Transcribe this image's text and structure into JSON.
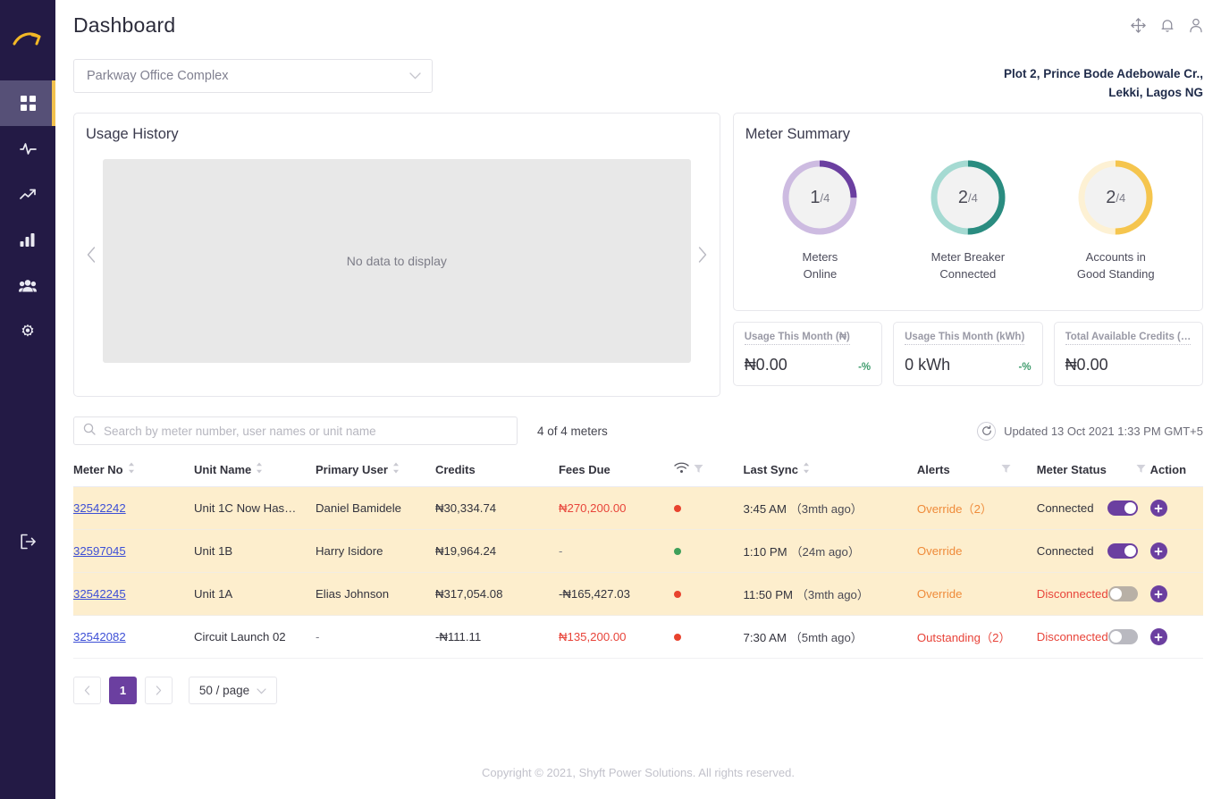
{
  "sidebar": {
    "logo_icon": "arrow-logo-icon",
    "items": [
      {
        "icon": "grid-dashboard-icon",
        "name": "dashboard",
        "active": true
      },
      {
        "icon": "activity-pulse-icon",
        "name": "activity",
        "active": false
      },
      {
        "icon": "trending-up-icon",
        "name": "trends",
        "active": false
      },
      {
        "icon": "bar-chart-icon",
        "name": "reports",
        "active": false
      },
      {
        "icon": "users-group-icon",
        "name": "users",
        "active": false
      },
      {
        "icon": "gear-settings-icon",
        "name": "settings",
        "active": false
      }
    ],
    "logout_icon": "logout-icon"
  },
  "header": {
    "title": "Dashboard",
    "icons": [
      "move-arrows-icon",
      "bell-icon",
      "user-account-icon"
    ],
    "address_line1": "Plot 2, Prince Bode Adebowale Cr.,",
    "address_line2": "Lekki, Lagos NG"
  },
  "site_select": {
    "value": "Parkway Office Complex",
    "chevron_icon": "chevron-down-icon"
  },
  "usage_history": {
    "title": "Usage History",
    "empty_message": "No data to display",
    "prev_icon": "chevron-left-icon",
    "next_icon": "chevron-right-icon"
  },
  "meter_summary": {
    "title": "Meter Summary",
    "donuts": [
      {
        "value": "1",
        "denominator": "/4",
        "caption_line1": "Meters",
        "caption_line2": "Online",
        "percent": 25,
        "color": "#6b3fa0",
        "track": "#cdbbe1"
      },
      {
        "value": "2",
        "denominator": "/4",
        "caption_line1": "Meter Breaker",
        "caption_line2": "Connected",
        "percent": 50,
        "color": "#2a8c80",
        "track": "#a5dad2"
      },
      {
        "value": "2",
        "denominator": "/4",
        "caption_line1": "Accounts in",
        "caption_line2": "Good Standing",
        "percent": 50,
        "color": "#f5c54e",
        "track": "#fdf1d4"
      }
    ]
  },
  "stats": [
    {
      "label": "Usage This Month (₦)",
      "value": "₦0.00",
      "delta": "-%"
    },
    {
      "label": "Usage This Month (kWh)",
      "value": "0 kWh",
      "delta": "-%"
    },
    {
      "label": "Total Available Credits (…",
      "value": "₦0.00",
      "delta": ""
    }
  ],
  "toolbar": {
    "search_placeholder": "Search by meter number, user names or unit name",
    "search_value": "",
    "search_icon": "search-icon",
    "meter_count": "4 of 4 meters",
    "refresh_icon": "refresh-icon",
    "updated_text": "Updated 13 Oct 2021 1:33 PM GMT+5"
  },
  "table": {
    "columns": [
      {
        "label": "Meter No",
        "sortable": true,
        "filter": false
      },
      {
        "label": "Unit Name",
        "sortable": true,
        "filter": false
      },
      {
        "label": "Primary User",
        "sortable": true,
        "filter": false
      },
      {
        "label": "Credits",
        "sortable": false,
        "filter": false
      },
      {
        "label": "Fees Due",
        "sortable": false,
        "filter": false
      },
      {
        "label": "",
        "icon": "wifi-icon",
        "sortable": false,
        "filter": true
      },
      {
        "label": "Last Sync",
        "sortable": true,
        "filter": false
      },
      {
        "label": "Alerts",
        "sortable": false,
        "filter": true
      },
      {
        "label": "Meter Status",
        "sortable": false,
        "filter": true
      },
      {
        "label": "Action",
        "sortable": false,
        "filter": false
      }
    ],
    "rows": [
      {
        "highlight": true,
        "meter_no": "32542242",
        "unit_name": "Unit 1C Now Has…",
        "primary_user": "Daniel Bamidele",
        "credits": "₦30,334.74",
        "credits_style": "normal",
        "fees_due": "₦270,200.00",
        "fees_style": "red",
        "signal": "red",
        "last_sync_time": "3:45 AM",
        "last_sync_ago": "（3mth ago）",
        "alerts": "Override（2）",
        "alerts_style": "orange",
        "meter_status": "Connected",
        "status_style": "normal",
        "toggle": "on",
        "action_icon": "plus-circle-icon"
      },
      {
        "highlight": true,
        "meter_no": "32597045",
        "unit_name": "Unit 1B",
        "primary_user": "Harry Isidore",
        "credits": "₦19,964.24",
        "credits_style": "normal",
        "fees_due": "-",
        "fees_style": "muted",
        "signal": "green",
        "last_sync_time": "1:10 PM",
        "last_sync_ago": "（24m ago）",
        "alerts": "Override",
        "alerts_style": "orange",
        "meter_status": "Connected",
        "status_style": "normal",
        "toggle": "on",
        "action_icon": "plus-circle-icon"
      },
      {
        "highlight": true,
        "meter_no": "32542245",
        "unit_name": "Unit 1A",
        "primary_user": "Elias Johnson",
        "credits": "₦317,054.08",
        "credits_style": "normal",
        "fees_due": "-₦165,427.03",
        "fees_style": "normal",
        "signal": "red",
        "last_sync_time": "11:50 PM",
        "last_sync_ago": "（3mth ago）",
        "alerts": "Override",
        "alerts_style": "orange",
        "meter_status": "Disconnected",
        "status_style": "red",
        "toggle": "off",
        "action_icon": "plus-circle-icon"
      },
      {
        "highlight": false,
        "meter_no": "32542082",
        "unit_name": "Circuit Launch 02",
        "primary_user": "-",
        "credits": "-₦111.11",
        "credits_style": "normal",
        "fees_due": "₦135,200.00",
        "fees_style": "red",
        "signal": "red",
        "last_sync_time": "7:30 AM",
        "last_sync_ago": "（5mth ago）",
        "alerts": "Outstanding（2）",
        "alerts_style": "red",
        "meter_status": "Disconnected",
        "status_style": "red",
        "toggle": "off",
        "action_icon": "plus-circle-icon"
      }
    ]
  },
  "pagination": {
    "prev_icon": "chevron-left-icon",
    "next_icon": "chevron-right-icon",
    "current_page": "1",
    "per_page": "50 / page",
    "chevron_icon": "chevron-down-icon"
  },
  "footer": {
    "text": "Copyright © 2021, Shyft Power Solutions. All rights reserved."
  }
}
